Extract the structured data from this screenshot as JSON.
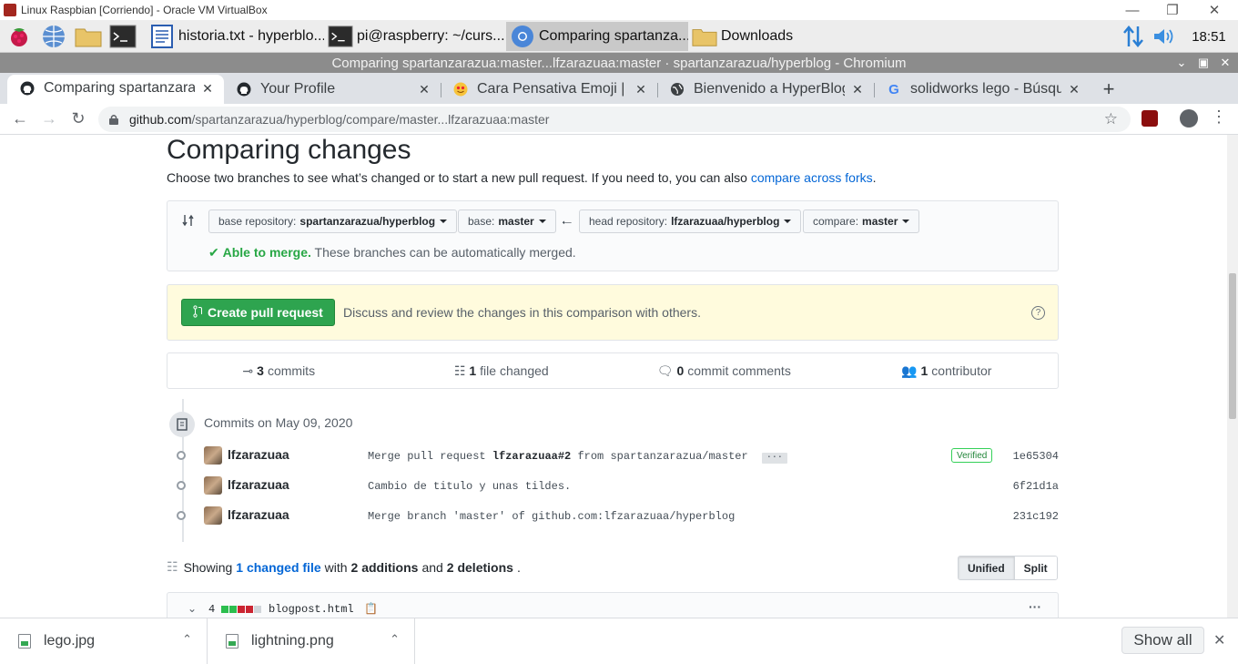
{
  "vbox": {
    "title": "Linux Raspbian [Corriendo] - Oracle VM VirtualBox"
  },
  "taskbar": {
    "tasks": [
      {
        "label": "historia.txt - hyperblo..."
      },
      {
        "label": "pi@raspberry: ~/curs..."
      },
      {
        "label": "Comparing spartanza..."
      },
      {
        "label": "Downloads"
      }
    ],
    "clock": "18:51"
  },
  "chrome": {
    "window_title": "Comparing spartanzarazua:master...lfzarazuaa:master · spartanzarazua/hyperblog - Chromium",
    "tabs": [
      {
        "label": "Comparing spartanzaraz"
      },
      {
        "label": "Your Profile"
      },
      {
        "label": "Cara Pensativa Emoji | "
      },
      {
        "label": "Bienvenido a HyperBlog"
      },
      {
        "label": "solidworks lego - Búsque"
      }
    ],
    "url_host": "github.com",
    "url_path": "/spartanzarazua/hyperblog/compare/master...lfzarazuaa:master"
  },
  "page": {
    "title": "Comparing changes",
    "subtitle": "Choose two branches to see what’s changed or to start a new pull request. If you need to, you can also",
    "subtitle_link": "compare across forks",
    "base_repo_label": "base repository:",
    "base_repo": "spartanzarazua/hyperblog",
    "base_label": "base:",
    "base": "master",
    "head_repo_label": "head repository:",
    "head_repo": "lfzarazuaa/hyperblog",
    "compare_label": "compare:",
    "compare": "master",
    "merge_ok": "Able to merge.",
    "merge_text": "These branches can be automatically merged.",
    "pr_button": "Create pull request",
    "pr_desc": "Discuss and review the changes in this comparison with others.",
    "stats": {
      "commits": "3",
      "commits_label": "commits",
      "files": "1",
      "files_label": "file changed",
      "comments": "0",
      "comments_label": "commit comments",
      "contributors": "1",
      "contributors_label": "contributor"
    },
    "commits_day": "Commits on May 09, 2020",
    "commits": [
      {
        "author": "lfzarazuaa",
        "msg_pre": "Merge pull request",
        "msg_bold": "lfzarazuaa#2",
        "msg_post": "from spartanzarazua/master",
        "verified": "Verified",
        "sha": "1e65304"
      },
      {
        "author": "lfzarazuaa",
        "msg": "Cambio de titulo y unas tildes.",
        "sha": "6f21d1a"
      },
      {
        "author": "lfzarazuaa",
        "msg": "Merge branch 'master' of github.com:lfzarazuaa/hyperblog",
        "sha": "231c192"
      }
    ],
    "summary": {
      "showing": "Showing",
      "changed_link": "1 changed file",
      "with": "with",
      "additions": "2 additions",
      "and": "and",
      "deletions": "2 deletions"
    },
    "view_unified": "Unified",
    "view_split": "Split",
    "file": {
      "count": "4",
      "name": "blogpost.html"
    }
  },
  "downloads": [
    {
      "name": "lego.jpg"
    },
    {
      "name": "lightning.png"
    }
  ],
  "show_all": "Show all"
}
